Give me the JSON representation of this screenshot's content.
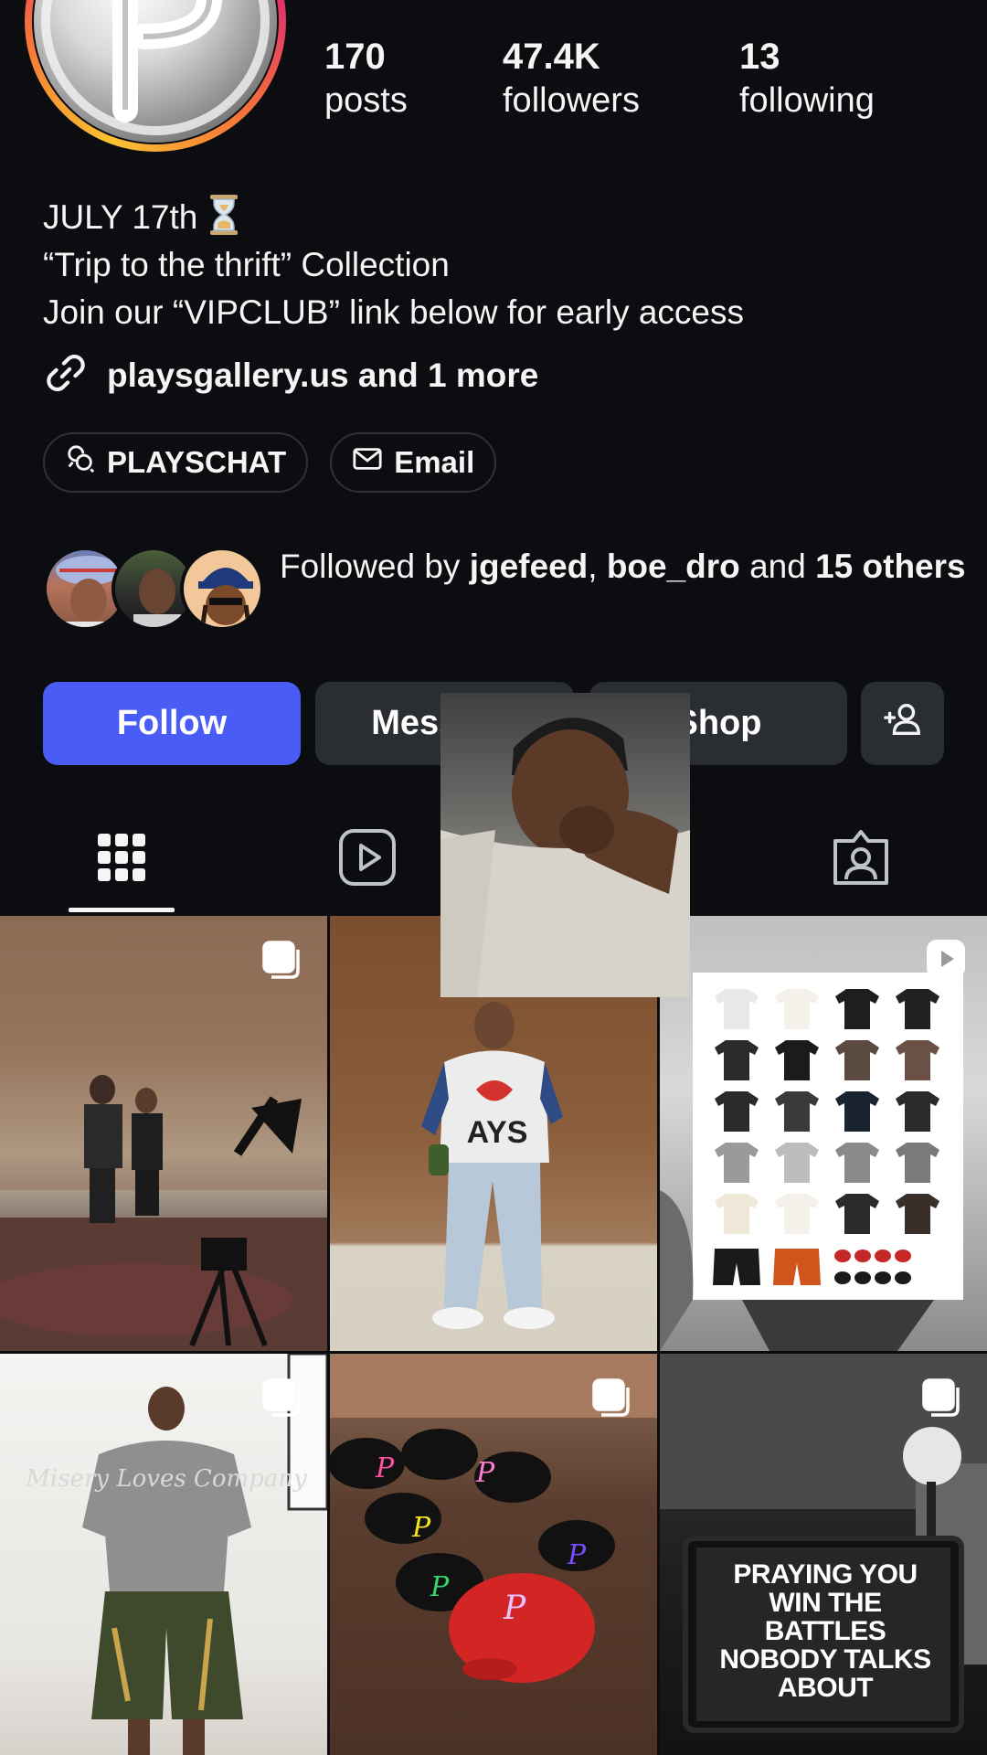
{
  "profile": {
    "stats": [
      {
        "value": "170",
        "label": "posts"
      },
      {
        "value": "47.4K",
        "label": "followers"
      },
      {
        "value": "13",
        "label": "following"
      }
    ],
    "bio": {
      "line1": "JULY 17th",
      "line1_emoji": "hourglass-emoji",
      "line2": "“Trip to the thrift” Collection",
      "line3": "Join our “VIPCLUB” link below for early access"
    },
    "link_text": "playsgallery.us and 1 more",
    "chips": [
      {
        "label": "PLAYSCHAT",
        "icon": "chat-threads-icon"
      },
      {
        "label": "Email",
        "icon": "envelope-icon"
      }
    ],
    "followed_by": {
      "prefix": "Followed by ",
      "user1": "jgefeed",
      "sep": ", ",
      "user2": "boe_dro",
      "mid": " and ",
      "others": "15 others"
    },
    "buttons": {
      "follow": "Follow",
      "message": "Message",
      "shop": "Shop"
    }
  },
  "tabs": [
    "grid-icon",
    "reels-icon",
    "tagged-icon"
  ],
  "grid": {
    "cells": [
      {
        "type": "carousel"
      },
      {
        "type": "photo",
        "shirt_text": "AYS"
      },
      {
        "type": "reel"
      },
      {
        "type": "carousel",
        "shirt_text": "Misery Loves Company"
      },
      {
        "type": "carousel"
      },
      {
        "type": "carousel",
        "sign_text": "PRAYING YOU WIN THE BATTLES NOBODY TALKS ABOUT"
      }
    ]
  },
  "colors": {
    "background": "#0b0d10",
    "follow_button": "#4a5cf6",
    "secondary_button": "#2a2d31",
    "text": "#f5f5f5"
  }
}
